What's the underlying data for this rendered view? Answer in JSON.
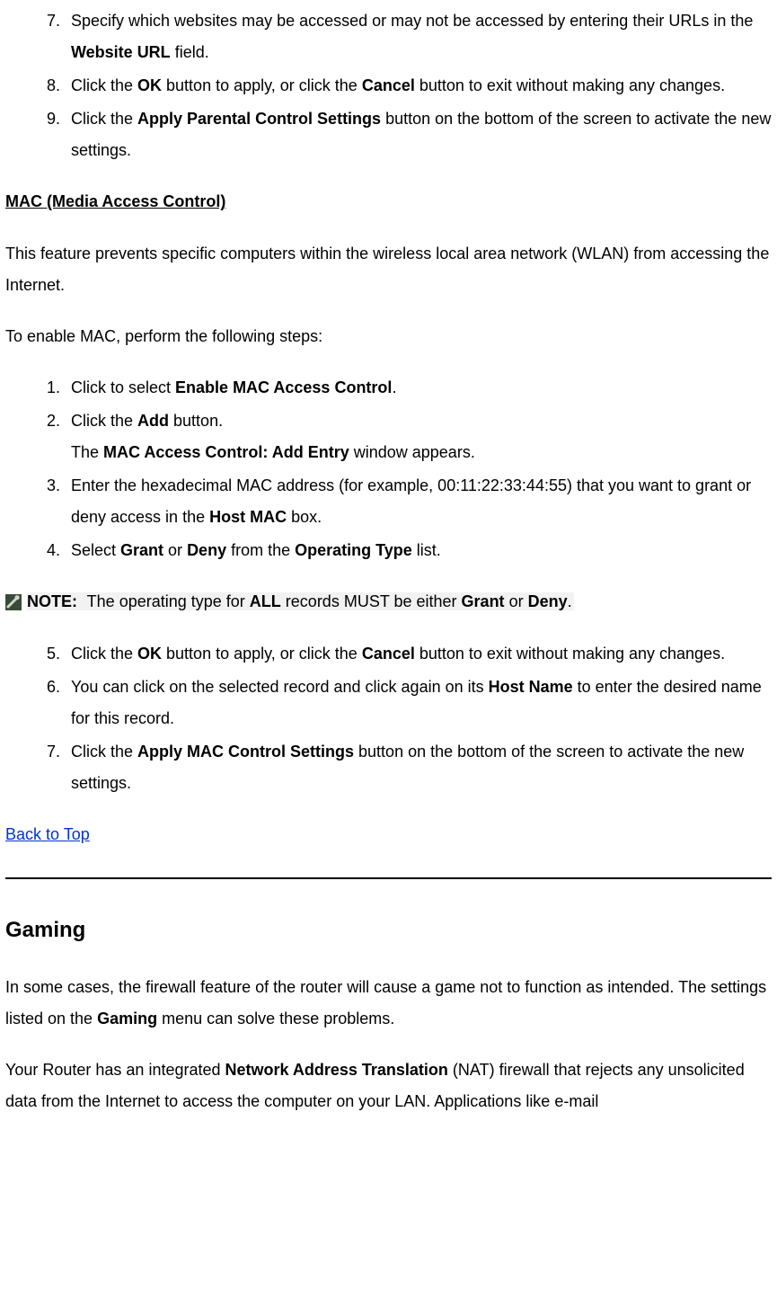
{
  "listA": {
    "i7_a": "Specify which websites may be accessed or may not be accessed by entering their URLs in the ",
    "i7_b": "Website URL",
    "i7_c": " field.",
    "i8_a": "Click the ",
    "i8_b": "OK",
    "i8_c": " button to apply, or click the ",
    "i8_d": "Cancel",
    "i8_e": " button to exit without making any changes.",
    "i9_a": "Click the ",
    "i9_b": "Apply Parental Control Settings",
    "i9_c": " button on the bottom of the screen to activate the new settings."
  },
  "mac": {
    "heading": "MAC (Media Access Control)",
    "intro": "This feature prevents specific computers within the wireless local area network (WLAN) from accessing the Internet.",
    "lead": "To enable MAC, perform the following steps:"
  },
  "listB": {
    "i1_a": "Click to select ",
    "i1_b": "Enable MAC Access Control",
    "i1_c": ".",
    "i2_a": "Click the ",
    "i2_b": "Add",
    "i2_c": " button.",
    "i2_sub_a": "The ",
    "i2_sub_b": "MAC Access Control: Add Entry",
    "i2_sub_c": " window appears.",
    "i3_a": "Enter the hexadecimal MAC address (for example, 00:11:22:33:44:55) that you want to grant or deny access in the ",
    "i3_b": "Host MAC",
    "i3_c": " box.",
    "i4_a": "Select ",
    "i4_b": "Grant",
    "i4_c": " or ",
    "i4_d": "Deny",
    "i4_e": " from the ",
    "i4_f": "Operating Type",
    "i4_g": " list."
  },
  "note": {
    "label": "NOTE:",
    "a": " The operating type for ",
    "b": "ALL",
    "c": " records MUST be either ",
    "d": "Grant",
    "e": " or ",
    "f": "Deny",
    "g": "."
  },
  "listC": {
    "i5_a": "Click the ",
    "i5_b": "OK",
    "i5_c": " button to apply, or click the ",
    "i5_d": "Cancel",
    "i5_e": " button to exit without making any changes.",
    "i6_a": "You can click on the selected record and click again on its ",
    "i6_b": "Host Name",
    "i6_c": " to enter the desired name for this record.",
    "i7_a": "Click the ",
    "i7_b": "Apply MAC Control Settings",
    "i7_c": " button on the bottom of the screen to activate the new settings."
  },
  "back_top": "Back to Top",
  "gaming": {
    "heading": "Gaming",
    "p1_a": "In some cases, the firewall feature of the router will cause a game not to function as intended. The settings listed on the ",
    "p1_b": "Gaming",
    "p1_c": " menu can solve these problems.",
    "p2_a": "Your Router has an integrated ",
    "p2_b": "Network Address Translation",
    "p2_c": " (NAT) firewall that rejects any unsolicited data from the Internet to access the computer on your LAN. Applications like e-mail"
  }
}
